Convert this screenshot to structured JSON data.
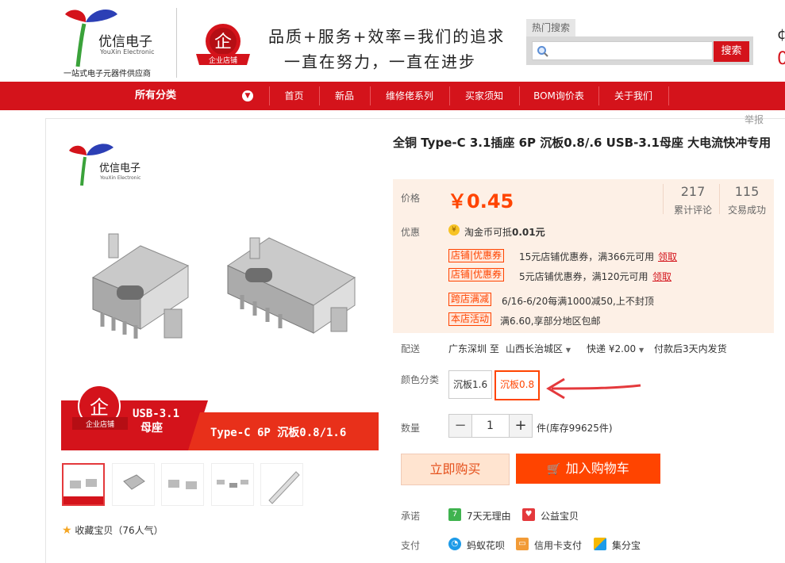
{
  "header": {
    "logo_name": "优信电子",
    "logo_en": "YouXin Electronic",
    "logo_sub": "一站式电子元器件供应商",
    "badge_text": "企业店铺",
    "slogan_line1": "品质+服务+效率=我们的追求",
    "slogan_line2": "一直在努力，一直在进步",
    "hot_search_label": "热门搜索",
    "search_button": "搜索",
    "search_value": "",
    "edge_top": "¢",
    "edge_bottom": "0"
  },
  "nav": {
    "all_categories": "所有分类",
    "items": [
      "首页",
      "新品",
      "维修佬系列",
      "买家须知",
      "BOM询价表",
      "关于我们"
    ]
  },
  "report": "举报",
  "main_image": {
    "logo_name": "优信电子",
    "logo_en": "YouXin Electronic",
    "badge_text": "企业店铺",
    "banner_line1": "USB-3.1",
    "banner_line2": "母座",
    "banner_right": "Type-C 6P 沉板0.8/1.6"
  },
  "favorite": "收藏宝贝（76人气）",
  "product": {
    "title": "全铜 Type-C 3.1插座 6P 沉板0.8/.6 USB-3.1母座 大电流快冲专用",
    "price_label": "价格",
    "price": "￥0.45",
    "reviews_count": "217",
    "reviews_label": "累计评论",
    "trades_count": "115",
    "trades_label": "交易成功",
    "promo_label": "优惠",
    "coin_text": "淘金币可抵",
    "coin_amount": "0.01元",
    "promos": [
      {
        "tag": "店铺|优惠券",
        "text": "15元店铺优惠券，满366元可用",
        "link": "领取"
      },
      {
        "tag": "店铺|优惠券",
        "text": "5元店铺优惠券，满120元可用",
        "link": "领取"
      }
    ],
    "events": [
      {
        "tag": "跨店满减",
        "text": "6/16-6/20每满1000减50,上不封顶"
      },
      {
        "tag": "本店活动",
        "text": "满6.60,享部分地区包邮"
      }
    ],
    "shipping_label": "配送",
    "shipping_from": "广东深圳 至",
    "shipping_to": "山西长治城区",
    "shipping_fee": "快递 ¥2.00",
    "shipping_note": "付款后3天内发货",
    "color_label": "颜色分类",
    "colors": [
      "沉板1.6",
      "沉板0.8"
    ],
    "selected_color": "沉板0.8",
    "qty_label": "数量",
    "qty_value": "1",
    "qty_minus": "−",
    "qty_plus": "+",
    "stock_text": "件(库存99625件)",
    "buy_now": "立即购买",
    "add_to_cart": "加入购物车",
    "promise_label": "承诺",
    "promises": [
      "7天无理由",
      "公益宝贝"
    ],
    "payment_label": "支付",
    "payments": [
      "蚂蚁花呗",
      "信用卡支付",
      "集分宝"
    ]
  },
  "colors": {
    "brand_red": "#d4131b",
    "accent_orange": "#ff4400",
    "price_panel": "#fdf0e6"
  }
}
